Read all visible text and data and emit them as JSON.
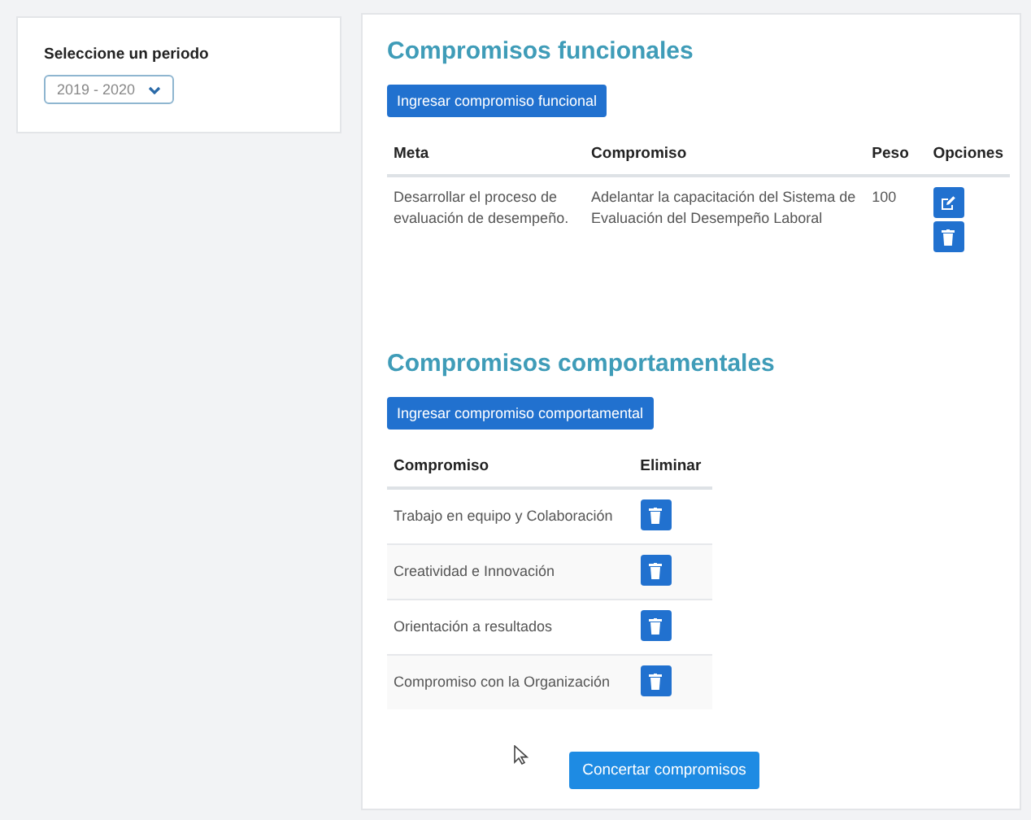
{
  "period": {
    "label": "Seleccione un periodo",
    "value": "2019 - 2020"
  },
  "functional": {
    "title": "Compromisos funcionales",
    "add_button": "Ingresar compromiso funcional",
    "columns": [
      "Meta",
      "Compromiso",
      "Peso",
      "Opciones"
    ],
    "rows": [
      {
        "meta": "Desarrollar el proceso de evaluación de desempeño.",
        "compromiso": "Adelantar la capacitación del Sistema de Evaluación del Desempeño Laboral",
        "peso": "100"
      }
    ]
  },
  "behavioral": {
    "title": "Compromisos comportamentales",
    "add_button": "Ingresar compromiso comportamental",
    "columns": [
      "Compromiso",
      "Eliminar"
    ],
    "rows": [
      {
        "compromiso": "Trabajo en equipo y Colaboración"
      },
      {
        "compromiso": "Creatividad e Innovación"
      },
      {
        "compromiso": "Orientación a resultados"
      },
      {
        "compromiso": "Compromiso con la Organización"
      }
    ]
  },
  "submit_button": "Concertar compromisos"
}
